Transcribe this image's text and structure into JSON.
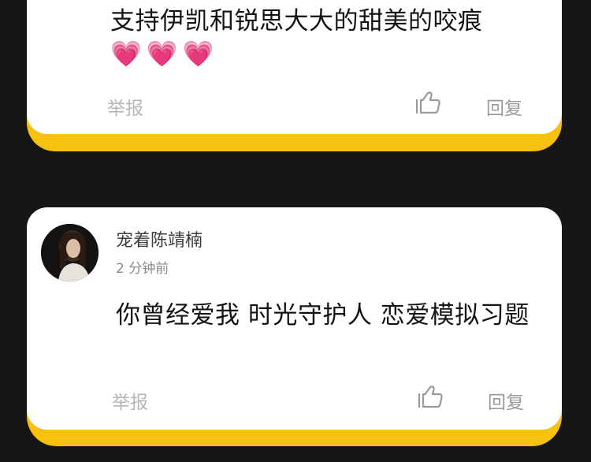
{
  "comments": [
    {
      "text": "支持伊凯和锐思大大的甜美的咬痕",
      "hearts": "💗💗💗",
      "report_label": "举报",
      "reply_label": "回复",
      "like_icon": "thumbs-up-icon"
    },
    {
      "username": "宠着陈靖楠",
      "timestamp": "2 分钟前",
      "text": "你曾经爱我 时光守护人 恋爱模拟习题",
      "report_label": "举报",
      "reply_label": "回复",
      "like_icon": "thumbs-up-icon"
    }
  ],
  "colors": {
    "background": "#161616",
    "card": "#ffffff",
    "accent": "#f6c10f"
  }
}
